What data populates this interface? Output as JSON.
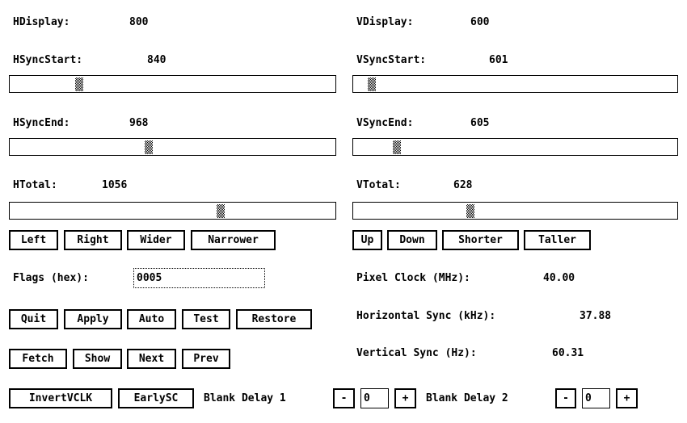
{
  "horizontal": {
    "hdisplay": {
      "label": "HDisplay:",
      "value": "800"
    },
    "hsyncstart": {
      "label": "HSyncStart:",
      "value": "840"
    },
    "hsyncend": {
      "label": "HSyncEnd:",
      "value": "968"
    },
    "htotal": {
      "label": "HTotal:",
      "value": "1056"
    },
    "buttons": [
      "Left",
      "Right",
      "Wider",
      "Narrower"
    ]
  },
  "vertical": {
    "vdisplay": {
      "label": "VDisplay:",
      "value": "600"
    },
    "vsyncstart": {
      "label": "VSyncStart:",
      "value": "601"
    },
    "vsyncend": {
      "label": "VSyncEnd:",
      "value": "605"
    },
    "vtotal": {
      "label": "VTotal:",
      "value": "628"
    },
    "buttons": [
      "Up",
      "Down",
      "Shorter",
      "Taller"
    ]
  },
  "flags": {
    "label": "Flags (hex):",
    "value": "0005"
  },
  "info": {
    "pixel_clock": {
      "label": "Pixel Clock (MHz):",
      "value": "40.00"
    },
    "hsync": {
      "label": "Horizontal Sync (kHz):",
      "value": "37.88"
    },
    "vsync": {
      "label": "Vertical Sync (Hz):",
      "value": "60.31"
    }
  },
  "actions1": [
    "Quit",
    "Apply",
    "Auto",
    "Test",
    "Restore"
  ],
  "actions2": [
    "Fetch",
    "Show",
    "Next",
    "Prev"
  ],
  "bottom": {
    "invert": "InvertVCLK",
    "early": "EarlySC",
    "bd1_label": "Blank Delay 1",
    "bd1_value": "0",
    "bd2_label": "Blank Delay 2",
    "bd2_value": "0",
    "minus": "-",
    "plus": "+"
  }
}
